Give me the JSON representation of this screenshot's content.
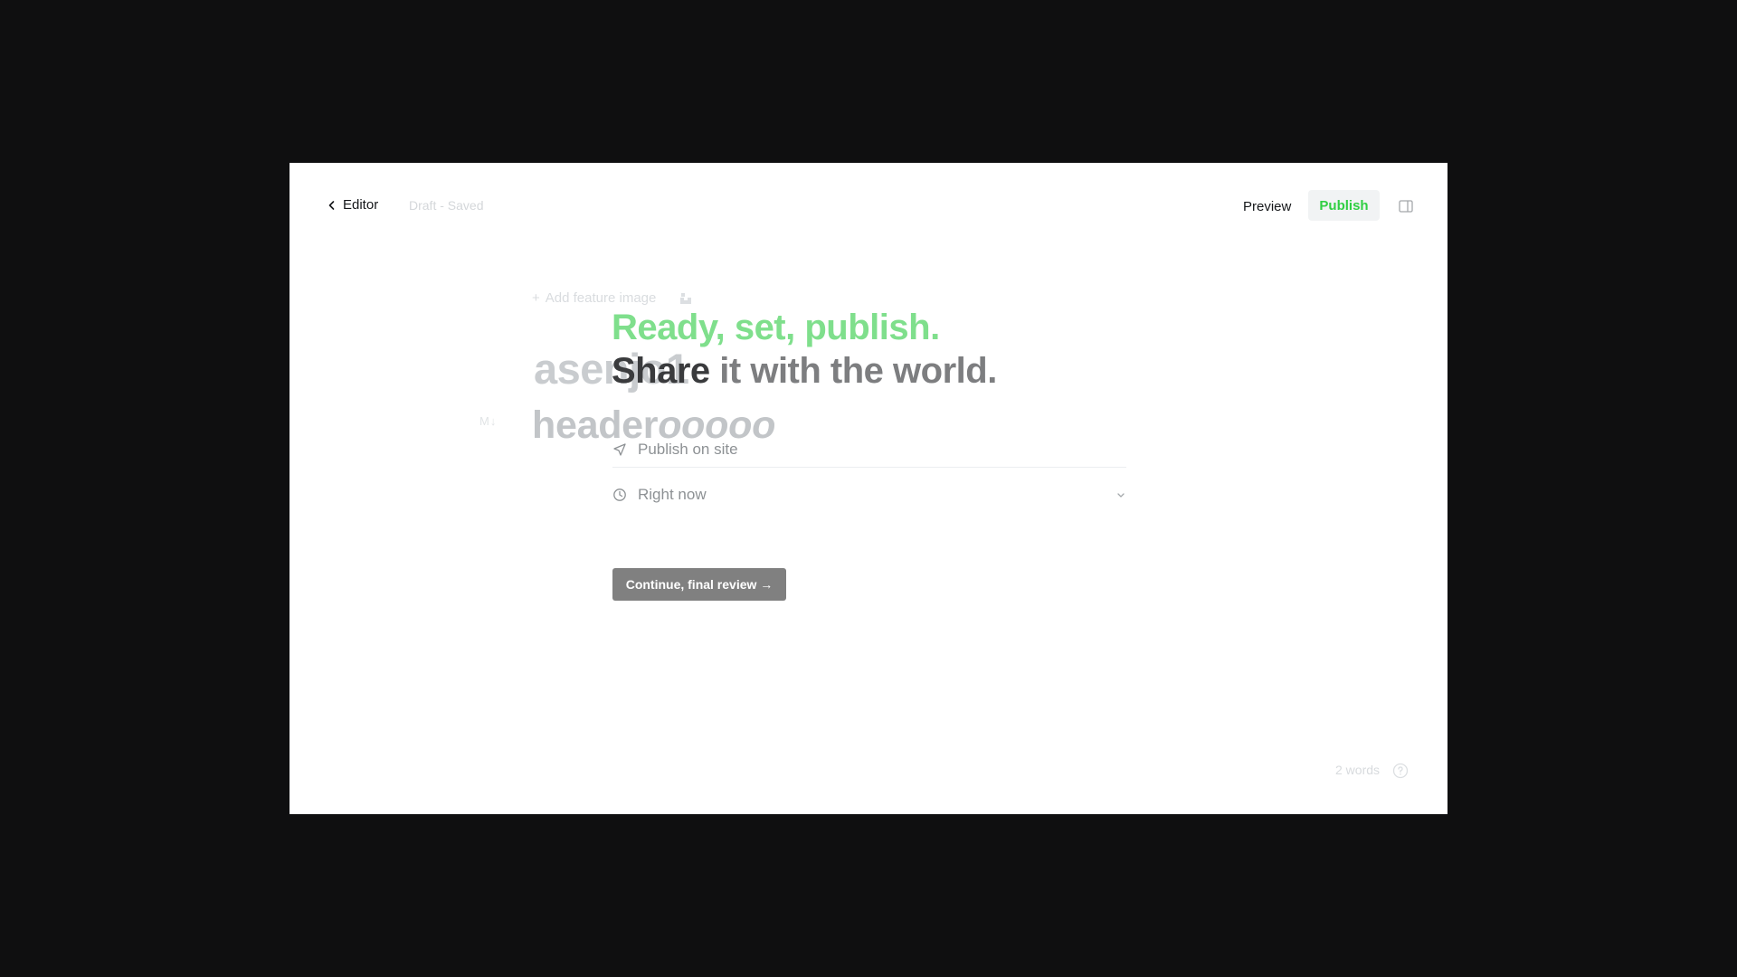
{
  "header": {
    "back_label": "Editor",
    "status": "Draft - Saved",
    "preview_label": "Preview",
    "publish_label": "Publish",
    "panel_icon": "sidebar-toggle-icon"
  },
  "editor": {
    "feature_image_label": "Add feature image",
    "post_title": "asenjo1",
    "markdown_badge": "M↓",
    "heading_plain": "header",
    "heading_italic": "ooooo"
  },
  "publish_flow": {
    "title_line1": "Ready, set, publish.",
    "title_line2_a": "Share",
    "title_line2_b": " it with the world.",
    "option_publish": "Publish on site",
    "option_time": "Right now",
    "continue_label": "Continue, final review →"
  },
  "footer": {
    "word_count": "2 words"
  },
  "colors": {
    "accent": "#30cf43",
    "background": "#0f0f10",
    "button_gray": "#808080"
  }
}
